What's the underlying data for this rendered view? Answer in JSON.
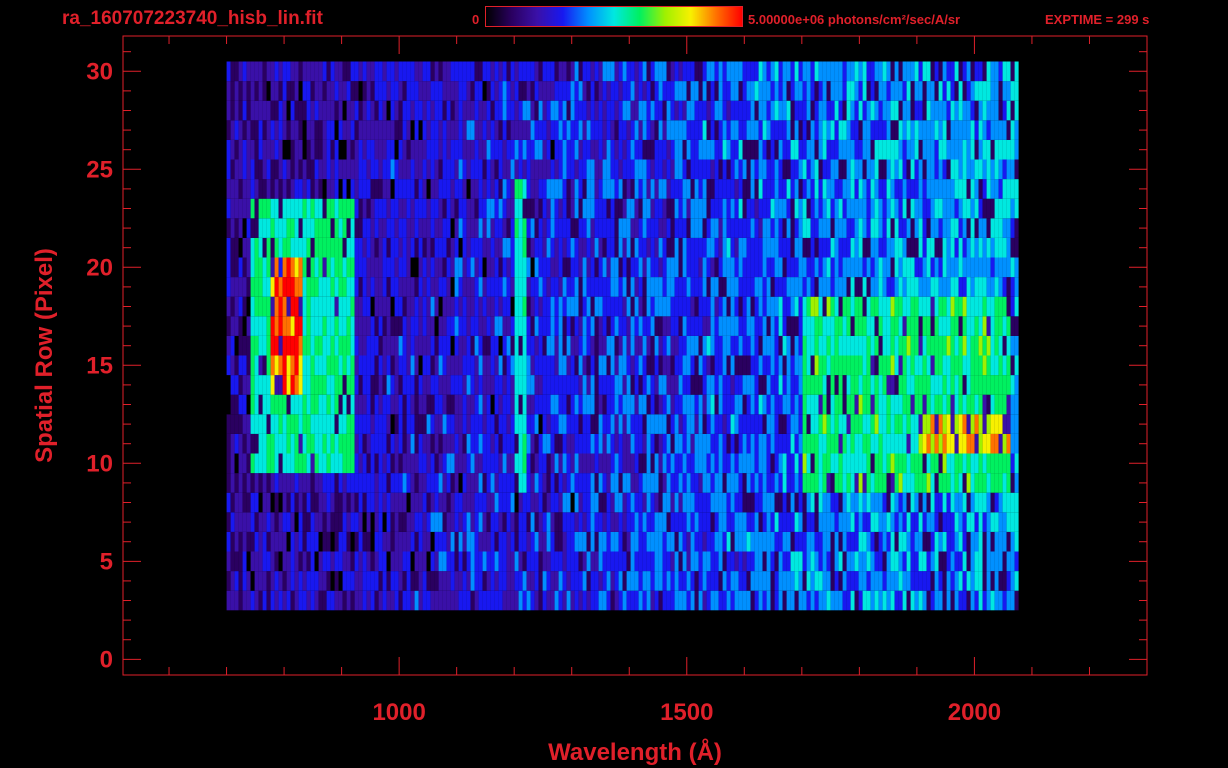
{
  "header": {
    "file_name": "ra_160707223740_hisb_lin.fit",
    "colorbar_min": "0",
    "colorbar_max": "5.00000e+06",
    "colorbar_units": "photons/cm²/sec/A/sr",
    "exptime": "EXPTIME = 299 s"
  },
  "colors": {
    "axis": "#e0202a",
    "background": "#000000",
    "colormap": [
      "#000000",
      "#2a0060",
      "#3a10a8",
      "#1818f0",
      "#0090ff",
      "#00e8e0",
      "#00f060",
      "#a0f000",
      "#f8f000",
      "#ff7000",
      "#ff0000"
    ]
  },
  "chart_data": {
    "type": "heatmap",
    "title": "ra_160707223740_hisb_lin.fit",
    "xlabel": "Wavelength (Å)",
    "ylabel": "Spatial Row (Pixel)",
    "xlim": [
      520,
      2300
    ],
    "ylim": [
      -0.8,
      31.8
    ],
    "x_ticks": [
      1000,
      1500,
      2000
    ],
    "y_ticks": [
      0,
      5,
      10,
      15,
      20,
      25,
      30
    ],
    "colorbar": {
      "min": 0,
      "max": 5000000,
      "units": "photons/cm²/sec/A/sr"
    },
    "exptime_s": 299,
    "data_extent": {
      "wavelength": [
        700,
        2070
      ],
      "rows": [
        3,
        30
      ]
    },
    "features": [
      {
        "wavelength": [
          770,
          830
        ],
        "rows": [
          14,
          20
        ],
        "level": 1.0
      },
      {
        "wavelength": [
          740,
          920
        ],
        "rows": [
          10,
          23
        ],
        "level": 0.58
      },
      {
        "wavelength": [
          1200,
          1220
        ],
        "rows": [
          9,
          24
        ],
        "level": 0.55
      },
      {
        "wavelength": [
          1700,
          2060
        ],
        "rows": [
          9,
          18
        ],
        "level": 0.6
      },
      {
        "wavelength": [
          1900,
          2060
        ],
        "rows": [
          11,
          12
        ],
        "level": 0.85
      }
    ]
  }
}
